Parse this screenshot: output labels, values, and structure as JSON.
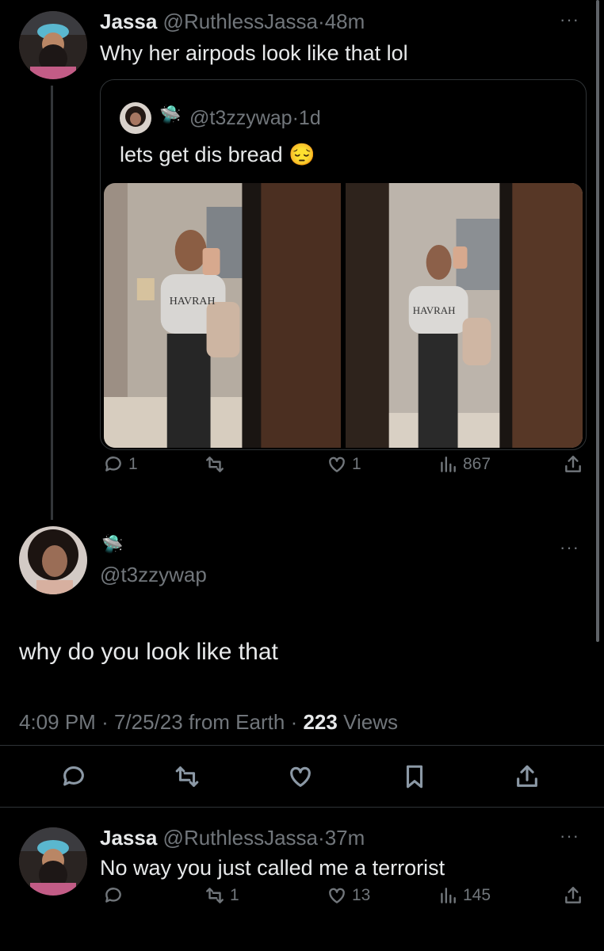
{
  "tweet1": {
    "name": "Jassa",
    "handle": "@RuthlessJassa",
    "sep": "·",
    "time": "48m",
    "text": "Why her airpods look like that lol",
    "more": "···"
  },
  "quote": {
    "handle": "@t3zzywap",
    "sep": "·",
    "time": "1d",
    "text": "lets get dis bread",
    "emoji": "😔",
    "ufo": "🛸",
    "photo_text": "HAVRAH"
  },
  "tweet1_actions": {
    "replies": "1",
    "likes": "1",
    "views": "867"
  },
  "main": {
    "ufo": "🛸",
    "handle": "@t3zzywap",
    "text": "why do you look like that",
    "time": "4:09 PM",
    "date": "7/25/23",
    "source": "from Earth",
    "views_count": "223",
    "views_label": "Views",
    "sep": "·",
    "more": "···"
  },
  "reply": {
    "name": "Jassa",
    "handle": "@RuthlessJassa",
    "sep": "·",
    "time": "37m",
    "text": "No way you just called me a terrorist",
    "retweets": "1",
    "likes": "13",
    "views": "145",
    "more": "···"
  }
}
